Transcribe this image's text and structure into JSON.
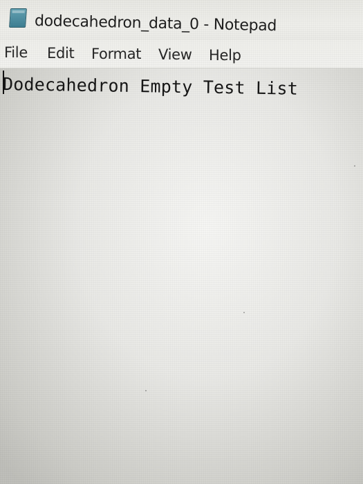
{
  "window": {
    "title": "dodecahedron_data_0 - Notepad",
    "icon": "notepad-icon"
  },
  "menu": {
    "file": "File",
    "edit": "Edit",
    "format": "Format",
    "view": "View",
    "help": "Help"
  },
  "document": {
    "text": "Dodecahedron Empty Test List"
  }
}
